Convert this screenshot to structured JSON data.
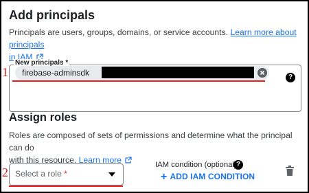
{
  "add_principals": {
    "title": "Add principals",
    "description": "Principals are users, groups, domains, or service accounts.",
    "learn_more_link": "Learn more about principals",
    "learn_more_link_cont": "in IAM",
    "field_label": "New principals *",
    "chip_value": "firebase-adminsdk",
    "annotation_number": "1"
  },
  "assign_roles": {
    "title": "Assign roles",
    "description_line1": "Roles are composed of sets of permissions and determine what the principal can do",
    "description_line2": "with this resource.",
    "learn_more_link": "Learn more",
    "select_placeholder": "Select a role",
    "select_required": "*",
    "iam_condition_label": "IAM condition (optional)",
    "add_condition_button": "ADD IAM CONDITION",
    "annotation_number": "2"
  },
  "colors": {
    "link": "#1a73e8",
    "annotation": "#e02020",
    "required": "#d93025"
  },
  "icons": [
    "external-link-icon",
    "chip-clear-icon",
    "help-icon",
    "dropdown-caret-icon",
    "plus-icon",
    "trash-icon"
  ]
}
